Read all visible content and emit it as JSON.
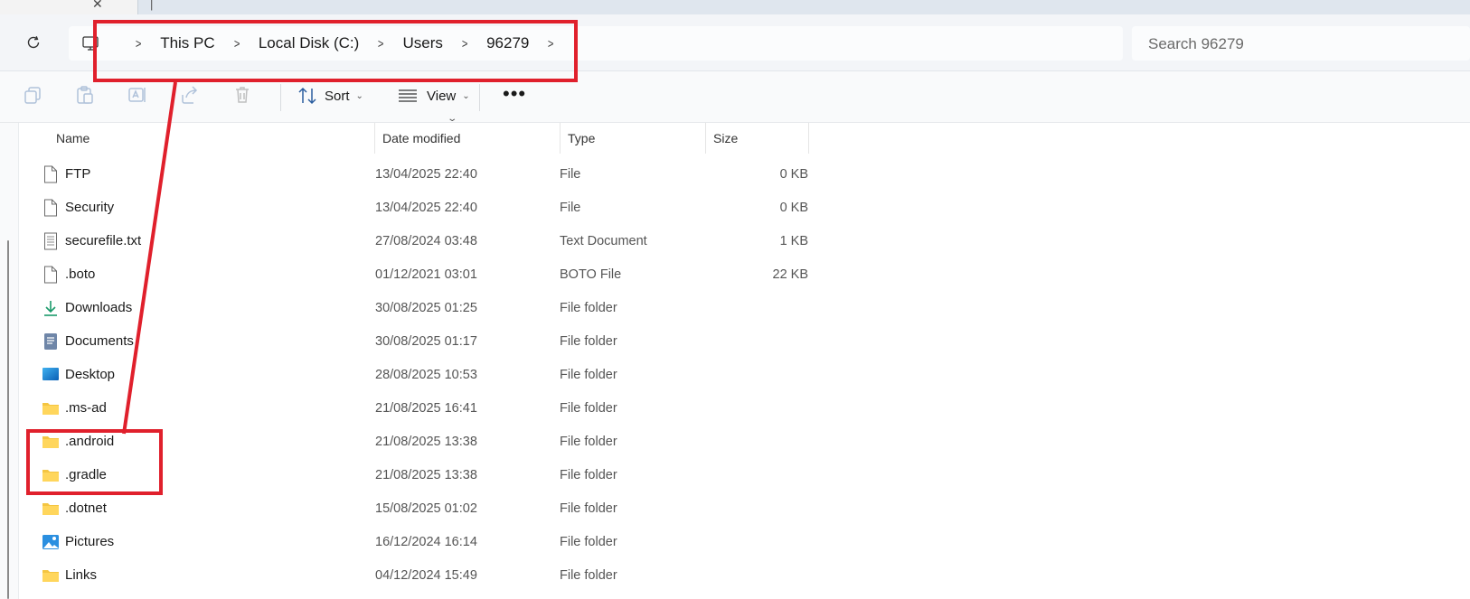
{
  "breadcrumb": [
    "This PC",
    "Local Disk (C:)",
    "Users",
    "96279"
  ],
  "search": {
    "placeholder": "Search 96279"
  },
  "toolbar": {
    "sort_label": "Sort",
    "view_label": "View"
  },
  "columns": {
    "name": "Name",
    "date": "Date modified",
    "type": "Type",
    "size": "Size"
  },
  "files": [
    {
      "name": "FTP",
      "date": "13/04/2025 22:40",
      "type": "File",
      "size": "0 KB",
      "icon": "file-icon"
    },
    {
      "name": "Security",
      "date": "13/04/2025 22:40",
      "type": "File",
      "size": "0 KB",
      "icon": "file-icon"
    },
    {
      "name": "securefile.txt",
      "date": "27/08/2024 03:48",
      "type": "Text Document",
      "size": "1 KB",
      "icon": "text-file-icon"
    },
    {
      "name": ".boto",
      "date": "01/12/2021 03:01",
      "type": "BOTO File",
      "size": "22 KB",
      "icon": "file-icon"
    },
    {
      "name": "Downloads",
      "date": "30/08/2025 01:25",
      "type": "File folder",
      "size": "",
      "icon": "downloads-icon"
    },
    {
      "name": "Documents",
      "date": "30/08/2025 01:17",
      "type": "File folder",
      "size": "",
      "icon": "documents-icon"
    },
    {
      "name": "Desktop",
      "date": "28/08/2025 10:53",
      "type": "File folder",
      "size": "",
      "icon": "desktop-icon"
    },
    {
      "name": ".ms-ad",
      "date": "21/08/2025 16:41",
      "type": "File folder",
      "size": "",
      "icon": "folder-icon"
    },
    {
      "name": ".android",
      "date": "21/08/2025 13:38",
      "type": "File folder",
      "size": "",
      "icon": "folder-icon"
    },
    {
      "name": ".gradle",
      "date": "21/08/2025 13:38",
      "type": "File folder",
      "size": "",
      "icon": "folder-icon"
    },
    {
      "name": ".dotnet",
      "date": "15/08/2025 01:02",
      "type": "File folder",
      "size": "",
      "icon": "folder-icon"
    },
    {
      "name": "Pictures",
      "date": "16/12/2024 16:14",
      "type": "File folder",
      "size": "",
      "icon": "pictures-icon"
    },
    {
      "name": "Links",
      "date": "04/12/2024 15:49",
      "type": "File folder",
      "size": "",
      "icon": "folder-icon"
    }
  ],
  "colors": {
    "annotation": "#e0202c",
    "folder": "#f4c542",
    "accent": "#0f7fd1"
  }
}
